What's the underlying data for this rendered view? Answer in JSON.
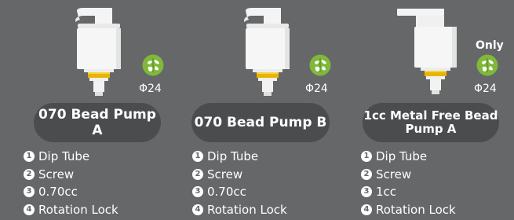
{
  "colors": {
    "background": "#666769",
    "pill": "#4b4c4e",
    "eco_green": "#7fb83a",
    "collar_yellow": "#e8b400"
  },
  "products": [
    {
      "name": "070 Bead Pump A",
      "size": "Φ24",
      "badge": "",
      "icon": "eco-leaf-globe-icon",
      "specs": [
        {
          "num": "1",
          "text": "Dip Tube"
        },
        {
          "num": "2",
          "text": "Screw"
        },
        {
          "num": "3",
          "text": "0.70cc"
        },
        {
          "num": "4",
          "text": "Rotation Lock"
        }
      ]
    },
    {
      "name": "070 Bead Pump B",
      "size": "Φ24",
      "badge": "",
      "icon": "eco-leaf-globe-icon",
      "specs": [
        {
          "num": "1",
          "text": "Dip Tube"
        },
        {
          "num": "2",
          "text": "Screw"
        },
        {
          "num": "3",
          "text": "0.70cc"
        },
        {
          "num": "4",
          "text": "Rotation Lock"
        }
      ]
    },
    {
      "name": "1cc Metal Free Bead Pump A",
      "name_line1": "1cc Metal Free Bead",
      "name_line2": "Pump A",
      "size": "Φ24",
      "badge": "Only",
      "icon": "eco-leaf-globe-icon",
      "specs": [
        {
          "num": "1",
          "text": "Dip Tube"
        },
        {
          "num": "2",
          "text": "Screw"
        },
        {
          "num": "3",
          "text": "1cc"
        },
        {
          "num": "4",
          "text": "Rotation Lock"
        }
      ]
    }
  ]
}
